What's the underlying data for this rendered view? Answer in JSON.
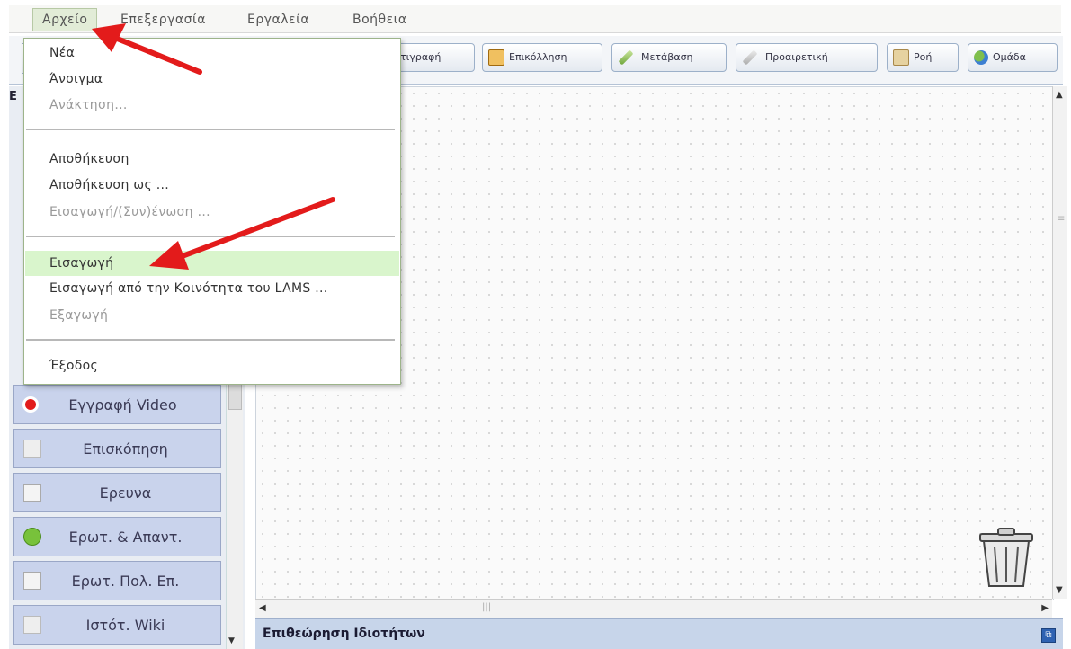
{
  "menubar": {
    "items": [
      "Αρχείο",
      "Επεξεργασία",
      "Εργαλεία",
      "Βοήθεια"
    ]
  },
  "toolbar": {
    "buttons": [
      "τιγραφή",
      "Επικόλληση",
      "Μετάβαση",
      "Προαιρετική",
      "Ροή",
      "Ομάδα"
    ]
  },
  "file_menu": {
    "items": [
      {
        "label": "Νέα",
        "enabled": true
      },
      {
        "label": "Άνοιγμα",
        "enabled": true
      },
      {
        "label": "Ανάκτηση...",
        "enabled": false
      },
      {
        "label": "Αποθήκευση",
        "enabled": true
      },
      {
        "label": "Αποθήκευση ως ...",
        "enabled": true
      },
      {
        "label": "Εισαγωγή/(Συν)ένωση ...",
        "enabled": false
      },
      {
        "label": "Εισαγωγή",
        "enabled": true,
        "highlighted": true
      },
      {
        "label": "Εισαγωγή από την Κοινότητα του LAMS ...",
        "enabled": true
      },
      {
        "label": "Εξαγωγή",
        "enabled": false
      },
      {
        "label": "Έξοδος",
        "enabled": true
      }
    ]
  },
  "palette": {
    "header": "E",
    "tools": [
      {
        "label": "Εγγραφή Video",
        "icon": "record-icon"
      },
      {
        "label": "Επισκόπηση",
        "icon": "document-icon"
      },
      {
        "label": "Ερευνα",
        "icon": "checklist-icon"
      },
      {
        "label": "Ερωτ. & Απαντ.",
        "icon": "question-icon"
      },
      {
        "label": "Ερωτ. Πολ. Επ.",
        "icon": "list-icon"
      },
      {
        "label": "Ιστότ. Wiki",
        "icon": "wiki-icon"
      }
    ]
  },
  "properties": {
    "title": "Επιθεώρηση Ιδιοτήτων"
  },
  "colors": {
    "highlight": "#d9f5cc",
    "palette_tool": "#c9d3ec",
    "annotation_arrow": "#e31b1b"
  }
}
